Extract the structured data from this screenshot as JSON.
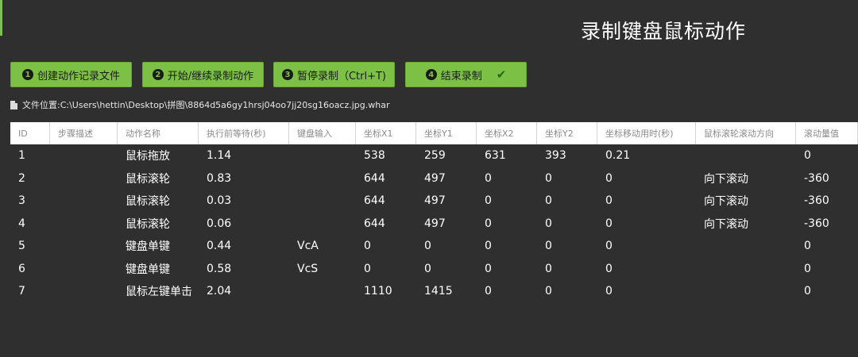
{
  "title": "录制键盘鼠标动作",
  "buttons": [
    {
      "num": "1",
      "label": "创建动作记录文件"
    },
    {
      "num": "2",
      "label": "开始/继续录制动作"
    },
    {
      "num": "3",
      "label": "暂停录制（Ctrl+T)"
    },
    {
      "num": "4",
      "label": "结束录制"
    }
  ],
  "file_location": {
    "label": "文件位置: ",
    "path": "C:\\Users\\hettin\\Desktop\\拼图\\8864d5a6gy1hrsj04oo7jj20sg16oacz.jpg.whar"
  },
  "table": {
    "headers": [
      "ID",
      "步骤描述",
      "动作名称",
      "执行前等待(秒)",
      "键盘输入",
      "坐标X1",
      "坐标Y1",
      "坐标X2",
      "坐标Y2",
      "坐标移动用时(秒)",
      "鼠标滚轮滚动方向",
      "滚动量值"
    ],
    "rows": [
      [
        "1",
        "",
        "鼠标拖放",
        "1.14",
        "",
        "538",
        "259",
        "631",
        "393",
        "0.21",
        "",
        "0"
      ],
      [
        "2",
        "",
        "鼠标滚轮",
        "0.83",
        "",
        "644",
        "497",
        "0",
        "0",
        "0",
        "向下滚动",
        "-360"
      ],
      [
        "3",
        "",
        "鼠标滚轮",
        "0.03",
        "",
        "644",
        "497",
        "0",
        "0",
        "0",
        "向下滚动",
        "-360"
      ],
      [
        "4",
        "",
        "鼠标滚轮",
        "0.06",
        "",
        "644",
        "497",
        "0",
        "0",
        "0",
        "向下滚动",
        "-360"
      ],
      [
        "5",
        "",
        "键盘单键",
        "0.44",
        "VcA",
        "0",
        "0",
        "0",
        "0",
        "0",
        "",
        "0"
      ],
      [
        "6",
        "",
        "键盘单键",
        "0.58",
        "VcS",
        "0",
        "0",
        "0",
        "0",
        "0",
        "",
        "0"
      ],
      [
        "7",
        "",
        "鼠标左键单击",
        "2.04",
        "",
        "1110",
        "1415",
        "0",
        "0",
        "0",
        "",
        "0"
      ]
    ]
  },
  "colors": {
    "background": "#2f2f2f",
    "button": "#7cc045",
    "header_bg": "#ffffff"
  }
}
